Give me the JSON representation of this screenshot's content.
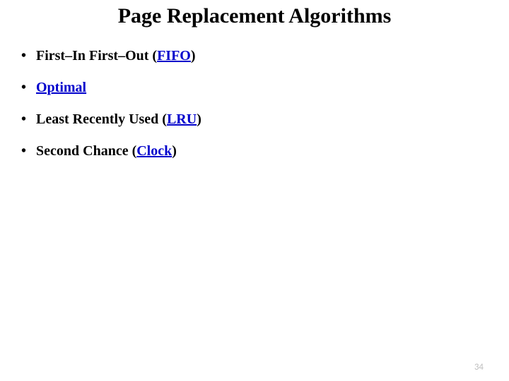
{
  "title": "Page Replacement Algorithms",
  "items": [
    {
      "prefix": "First–In First–Out (",
      "link": "FIFO",
      "suffix": ")"
    },
    {
      "prefix": "",
      "link": "Optimal",
      "suffix": ""
    },
    {
      "prefix": "Least Recently Used (",
      "link": "LRU",
      "suffix": ")"
    },
    {
      "prefix": "Second Chance (",
      "link": "Clock",
      "suffix": ")"
    }
  ],
  "page_number": "34"
}
